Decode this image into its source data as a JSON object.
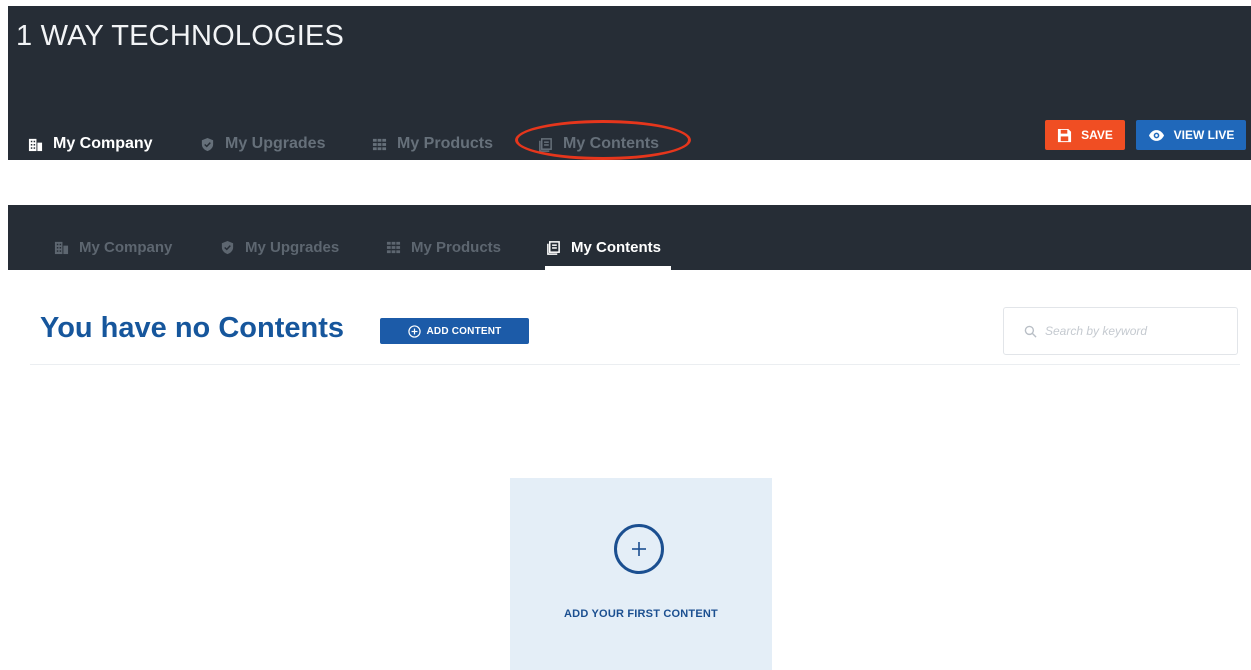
{
  "company": {
    "name": "1 WAY TECHNOLOGIES"
  },
  "top_nav": {
    "tabs": [
      {
        "label": "My Company",
        "icon": "building-icon",
        "active": true
      },
      {
        "label": "My Upgrades",
        "icon": "shield-icon",
        "active": false
      },
      {
        "label": "My Products",
        "icon": "grid-icon",
        "active": false
      },
      {
        "label": "My Contents",
        "icon": "contents-icon",
        "active": false,
        "highlighted": true
      }
    ],
    "save_label": "SAVE",
    "view_live_label": "VIEW LIVE"
  },
  "secondary_nav": {
    "tabs": [
      {
        "label": "My Company",
        "icon": "building-icon",
        "active": false
      },
      {
        "label": "My Upgrades",
        "icon": "shield-icon",
        "active": false
      },
      {
        "label": "My Products",
        "icon": "grid-icon",
        "active": false
      },
      {
        "label": "My Contents",
        "icon": "contents-icon",
        "active": true
      }
    ]
  },
  "content": {
    "title": "You have no Contents",
    "add_button_label": "ADD CONTENT",
    "search_placeholder": "Search by keyword",
    "empty_state_label": "ADD YOUR FIRST CONTENT"
  },
  "colors": {
    "header_bg": "#262d36",
    "save_orange": "#f04e23",
    "primary_blue": "#1c5ba8",
    "highlight_red": "#e6361c",
    "empty_card_bg": "#e4eef7"
  }
}
